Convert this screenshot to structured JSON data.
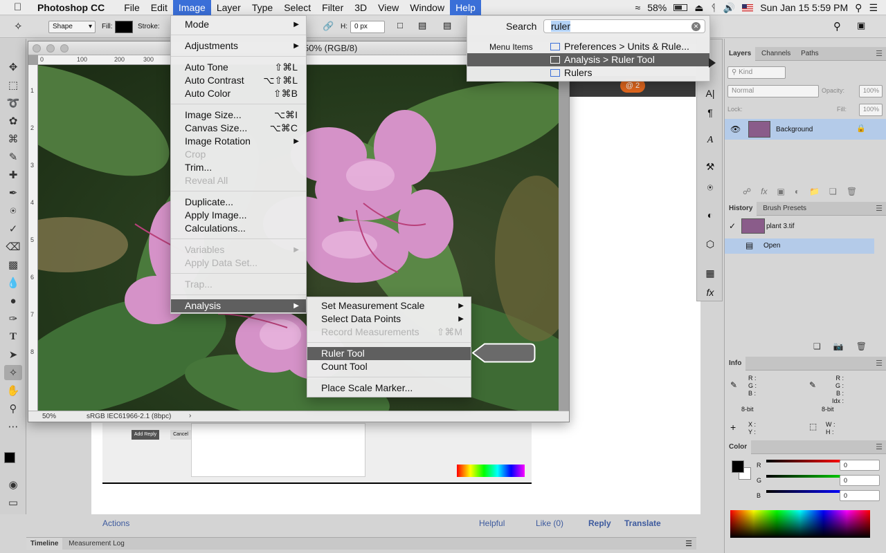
{
  "menubar": {
    "app_name": "Photoshop CC",
    "items": [
      "File",
      "Edit",
      "Image",
      "Layer",
      "Type",
      "Select",
      "Filter",
      "3D",
      "View",
      "Window",
      "Help"
    ],
    "battery": "58%",
    "clock": "Sun Jan 15  5:59 PM"
  },
  "optionsbar": {
    "mode": "Shape",
    "fill_label": "Fill:",
    "stroke_label": "Stroke:",
    "h_label": "H:",
    "h_value": "0 px"
  },
  "document": {
    "title": "50% (RGB/8)",
    "zoom": "50%",
    "profile": "sRGB IEC61966-2.1 (8bpc)",
    "ruler_h": [
      "0",
      "100",
      "200",
      "300"
    ],
    "ruler_v": [
      "1",
      "2",
      "3",
      "4",
      "5",
      "6",
      "7",
      "8"
    ]
  },
  "image_menu": {
    "items": [
      {
        "label": "Mode",
        "arrow": true,
        "disabled": false
      },
      {
        "label": "Adjustments",
        "arrow": true,
        "disabled": false
      },
      {
        "label": "Auto Tone",
        "shortcut": "⇧⌘L",
        "disabled": false
      },
      {
        "label": "Auto Contrast",
        "shortcut": "⌥⇧⌘L",
        "disabled": false
      },
      {
        "label": "Auto Color",
        "shortcut": "⇧⌘B",
        "disabled": false
      },
      {
        "label": "Image Size...",
        "shortcut": "⌥⌘I",
        "disabled": false
      },
      {
        "label": "Canvas Size...",
        "shortcut": "⌥⌘C",
        "disabled": false
      },
      {
        "label": "Image Rotation",
        "arrow": true,
        "disabled": false
      },
      {
        "label": "Crop",
        "disabled": true
      },
      {
        "label": "Trim...",
        "disabled": false
      },
      {
        "label": "Reveal All",
        "disabled": true
      },
      {
        "label": "Duplicate...",
        "disabled": false
      },
      {
        "label": "Apply Image...",
        "disabled": false
      },
      {
        "label": "Calculations...",
        "disabled": false
      },
      {
        "label": "Variables",
        "arrow": true,
        "disabled": true
      },
      {
        "label": "Apply Data Set...",
        "disabled": true
      },
      {
        "label": "Trap...",
        "disabled": true
      },
      {
        "label": "Analysis",
        "arrow": true,
        "disabled": false,
        "highlighted": true
      }
    ]
  },
  "analysis_submenu": {
    "items": [
      {
        "label": "Set Measurement Scale",
        "arrow": true,
        "disabled": false
      },
      {
        "label": "Select Data Points",
        "arrow": true,
        "disabled": false
      },
      {
        "label": "Record Measurements",
        "shortcut": "⇧⌘M",
        "disabled": true
      },
      {
        "label": "Ruler Tool",
        "disabled": false,
        "highlighted": true
      },
      {
        "label": "Count Tool",
        "disabled": false
      },
      {
        "label": "Place Scale Marker...",
        "disabled": false
      }
    ]
  },
  "help_menu": {
    "search_label": "Search",
    "search_value": "ruler",
    "section_label": "Menu Items",
    "results": [
      "Preferences > Units & Rule...",
      "Analysis > Ruler Tool",
      "Rulers"
    ]
  },
  "layers_panel": {
    "tabs": [
      "Layers",
      "Channels",
      "Paths"
    ],
    "kind": "Kind",
    "blend": "Normal",
    "opacity_label": "Opacity:",
    "opacity": "100%",
    "lock_label": "Lock:",
    "fill_label": "Fill:",
    "fill": "100%",
    "layer_name": "Background"
  },
  "history_panel": {
    "tabs": [
      "History",
      "Brush Presets"
    ],
    "snapshot": "plant 3.tif",
    "state": "Open"
  },
  "info_panel": {
    "tab": "Info",
    "r": "R :",
    "g": "G :",
    "b": "B :",
    "idx": "Idx :",
    "bit1": "8-bit",
    "bit2": "8-bit",
    "x": "X :",
    "y": "Y :",
    "w": "W :",
    "h": "H :"
  },
  "color_panel": {
    "tab": "Color",
    "r_label": "R",
    "g_label": "G",
    "b_label": "B",
    "r_value": "0",
    "g_value": "0",
    "b_value": "0"
  },
  "bottom_tabs": [
    "Timeline",
    "Measurement Log"
  ],
  "webpage": {
    "actions": "Actions",
    "helpful": "Helpful",
    "like": "Like (0)",
    "reply": "Reply",
    "translate": "Translate",
    "add_reply": "Add Reply",
    "cancel": "Cancel"
  }
}
